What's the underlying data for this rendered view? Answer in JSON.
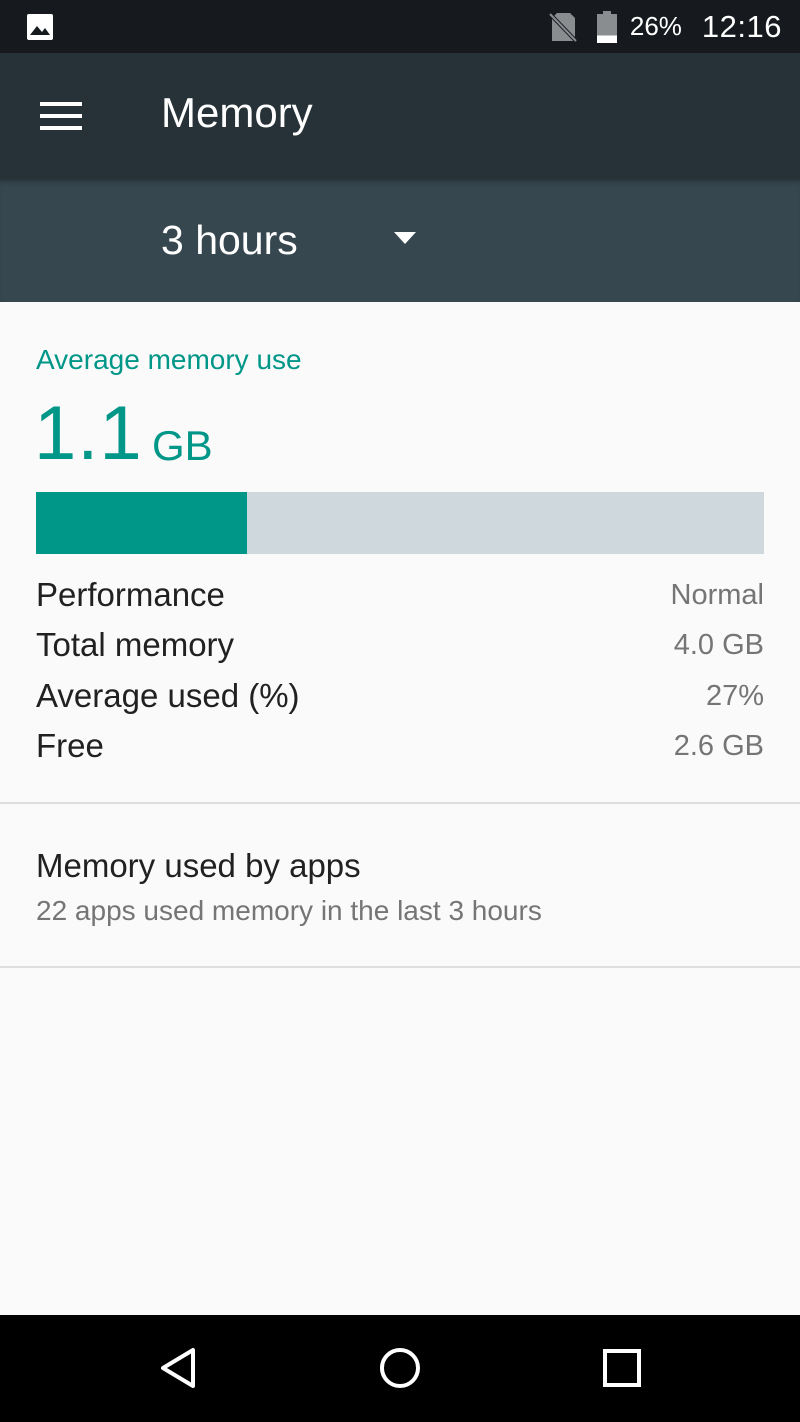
{
  "status_bar": {
    "battery_percent": "26%",
    "time": "12:16",
    "battery_level": 0.26,
    "icons": [
      "gallery-icon",
      "no-sim-icon",
      "battery-icon"
    ]
  },
  "app_bar": {
    "title": "Memory",
    "menu_icon": "hamburger-menu-icon"
  },
  "duration_selector": {
    "selected": "3 hours",
    "icon": "dropdown-arrow-icon"
  },
  "summary": {
    "heading": "Average memory use",
    "average_value": "1.1",
    "average_unit": "GB",
    "usage_fraction": 0.29,
    "colors": {
      "accent": "#009688",
      "track": "#cfd8dc"
    },
    "stats": [
      {
        "label": "Performance",
        "value": "Normal"
      },
      {
        "label": "Total memory",
        "value": "4.0 GB"
      },
      {
        "label": "Average used (%)",
        "value": "27%"
      },
      {
        "label": "Free",
        "value": "2.6 GB"
      }
    ]
  },
  "apps_item": {
    "title": "Memory used by apps",
    "subtitle": "22 apps used memory in the last 3 hours"
  },
  "nav_bar": {
    "icons": [
      "back-icon",
      "home-icon",
      "recents-icon"
    ]
  }
}
